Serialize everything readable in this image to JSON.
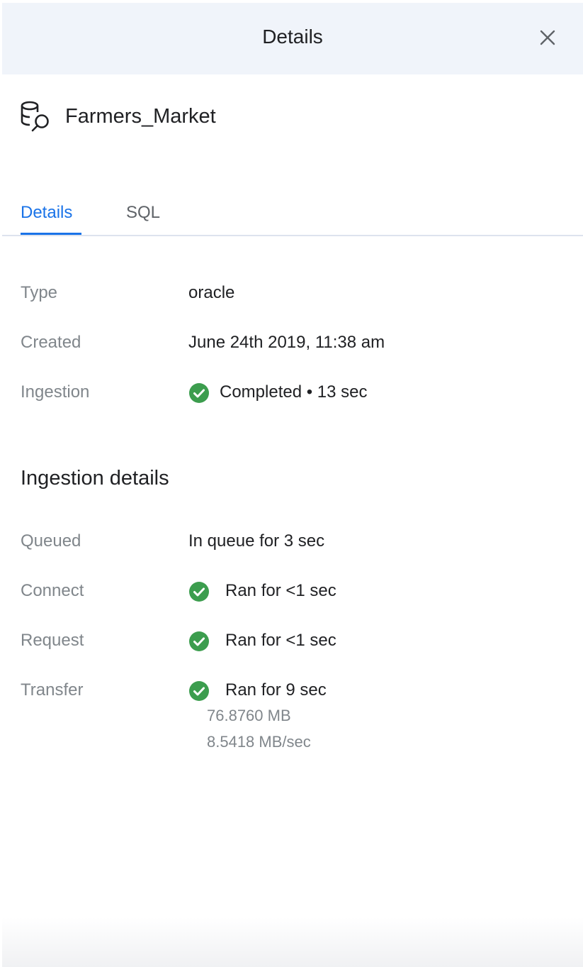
{
  "header": {
    "title": "Details",
    "close_icon": "close-icon"
  },
  "dataset": {
    "icon": "database-search-icon",
    "name": "Farmers_Market"
  },
  "tabs": [
    {
      "label": "Details",
      "active": true
    },
    {
      "label": "SQL",
      "active": false
    }
  ],
  "details": {
    "type": {
      "label": "Type",
      "value": "oracle"
    },
    "created": {
      "label": "Created",
      "value": "June 24th 2019, 11:38 am"
    },
    "ingestion": {
      "label": "Ingestion",
      "status_icon": "check-circle-icon",
      "value": "Completed • 13 sec"
    }
  },
  "ingestion_details": {
    "title": "Ingestion details",
    "queued": {
      "label": "Queued",
      "value": "In queue for 3 sec"
    },
    "connect": {
      "label": "Connect",
      "status_icon": "check-circle-icon",
      "value": "Ran for <1 sec"
    },
    "request": {
      "label": "Request",
      "status_icon": "check-circle-icon",
      "value": "Ran for <1 sec"
    },
    "transfer": {
      "label": "Transfer",
      "status_icon": "check-circle-icon",
      "value": "Ran for 9 sec",
      "size": "76.8760 MB",
      "rate": "8.5418 MB/sec"
    }
  },
  "colors": {
    "accent": "#1a73e8",
    "success": "#3c9d4e",
    "header_bg": "#f0f4fa",
    "label_gray": "#80868b"
  }
}
